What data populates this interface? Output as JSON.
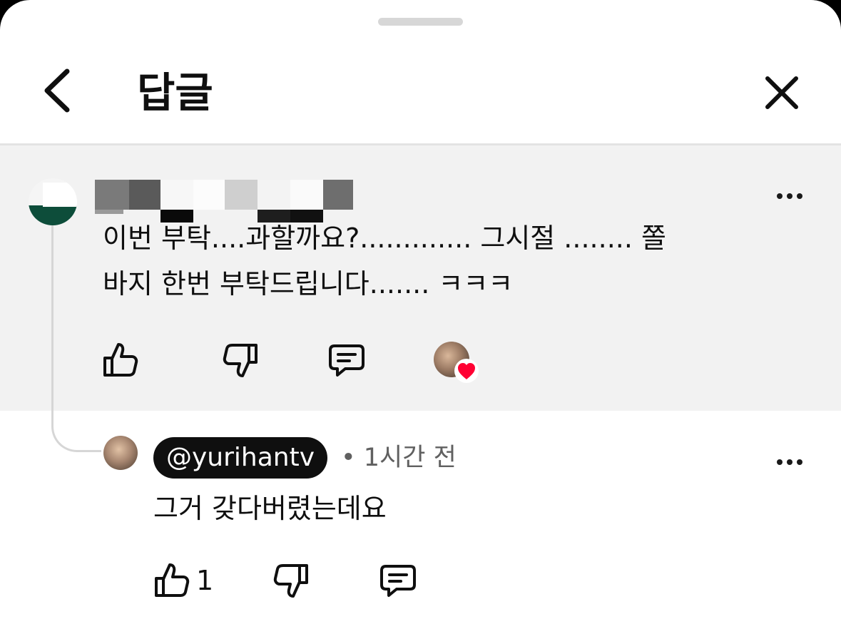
{
  "header": {
    "title": "답글"
  },
  "parent_comment": {
    "text": "이번 부탁....과할까요?............. 그시절 ........ 쫄\n바지 한번 부탁드립니다....... ㅋㅋㅋ"
  },
  "reply": {
    "handle": "@yurihantv",
    "time": "• 1시간 전",
    "text": "그거 갖다버렸는데요",
    "like_count": "1"
  },
  "icons": {
    "back": "chevron-left-icon",
    "close": "close-icon",
    "more": "more-vertical-icon",
    "like": "thumbs-up-icon",
    "dislike": "thumbs-down-icon",
    "reply": "comment-icon",
    "heart": "heart-icon"
  },
  "colors": {
    "heart": "#ff0033",
    "chip_bg": "#0f0f0f",
    "highlight_bg": "#f2f2f2",
    "notification_dot": "#ff1f3d"
  }
}
